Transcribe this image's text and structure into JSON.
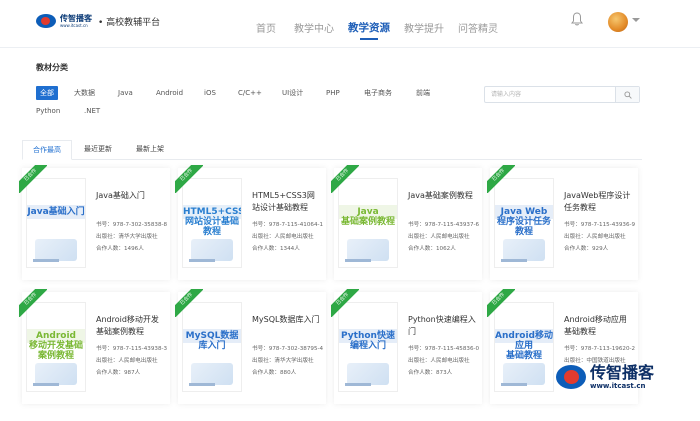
{
  "header": {
    "logo_cn": "传智播客",
    "logo_url": "www.itcast.cn",
    "platform": "• 高校教辅平台",
    "nav": [
      "首页",
      "教学中心",
      "教学资源",
      "教学提升",
      "问答精灵"
    ],
    "nav_active": 2
  },
  "category": {
    "title": "教材分类",
    "items": [
      "全部",
      "大数据",
      "Java",
      "Android",
      "iOS",
      "C/C++",
      "UI设计",
      "PHP",
      "电子商务",
      "前端",
      "Python",
      ".NET"
    ],
    "active": 0
  },
  "search": {
    "placeholder": "请输入内容"
  },
  "tabs": [
    "合作最高",
    "最近更新",
    "最新上架"
  ],
  "tab_active": 0,
  "books": [
    {
      "ribbon": "已合作",
      "cover_title": "Java基础入门",
      "name": "Java基础入门",
      "isbn": "书号：978-7-302-35838-8",
      "publisher": "出版社：清华大学出版社",
      "partners": "合作人数：1496人",
      "color": "#2a6fc9"
    },
    {
      "ribbon": "已合作",
      "cover_title": "HTML5+CSS3\n网站设计基础教程",
      "name": "HTML5+CSS3网站设计基础教程",
      "isbn": "书号：978-7-115-41064-1",
      "publisher": "出版社：人民邮电出版社",
      "partners": "合作人数：1344人",
      "color": "#2a7fd0"
    },
    {
      "ribbon": "已合作",
      "cover_title": "Java\n基础案例教程",
      "name": "Java基础案例教程",
      "isbn": "书号：978-7-115-43937-6",
      "publisher": "出版社：人民邮电出版社",
      "partners": "合作人数：1062人",
      "color": "#7ab834"
    },
    {
      "ribbon": "已合作",
      "cover_title": "Java Web\n程序设计任务教程",
      "name": "JavaWeb程序设计任务教程",
      "isbn": "书号：978-7-115-43936-9",
      "publisher": "出版社：人民邮电出版社",
      "partners": "合作人数：929人",
      "color": "#2a6fc9"
    },
    {
      "ribbon": "已合作",
      "cover_title": "Android\n移动开发基础\n案例教程",
      "name": "Android移动开发基础案例教程",
      "isbn": "书号：978-7-115-43938-3",
      "publisher": "出版社：人民邮电出版社",
      "partners": "合作人数：987人",
      "color": "#7ab834"
    },
    {
      "ribbon": "已合作",
      "cover_title": "MySQL数据库入门",
      "name": "MySQL数据库入门",
      "isbn": "书号：978-7-302-38795-4",
      "publisher": "出版社：清华大学出版社",
      "partners": "合作人数：880人",
      "color": "#2a6fc9"
    },
    {
      "ribbon": "已合作",
      "cover_title": "Python快速编程入门",
      "name": "Python快速编程入门",
      "isbn": "书号：978-7-115-45836-0",
      "publisher": "出版社：人民邮电出版社",
      "partners": "合作人数：873人",
      "color": "#2a6fc9"
    },
    {
      "ribbon": "已合作",
      "cover_title": "Android移动应用\n基础教程",
      "name": "Android移动应用基础教程",
      "isbn": "书号：978-7-113-19620-2",
      "publisher": "出版社：中国铁道出版社",
      "partners": "",
      "color": "#2a6fc9"
    }
  ],
  "watermark": {
    "cn": "传智播客",
    "url": "www.itcast.cn"
  }
}
